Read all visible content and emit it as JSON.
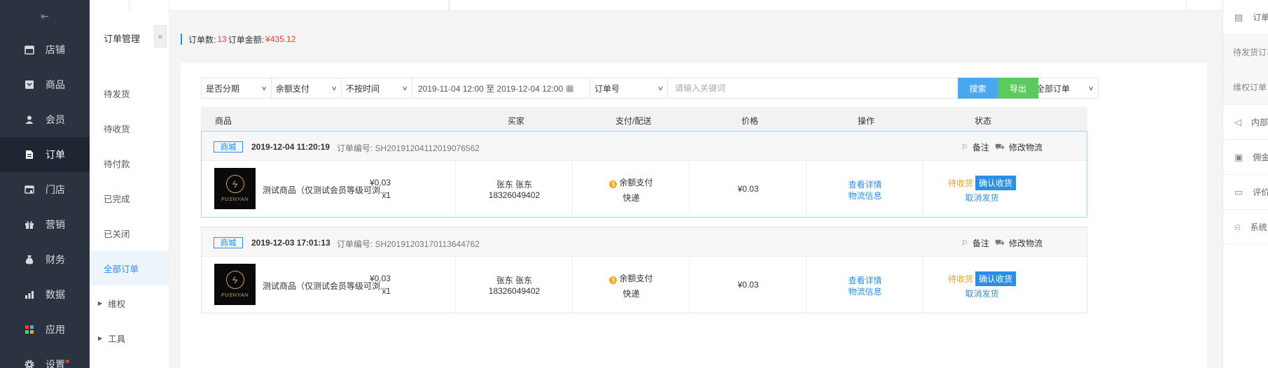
{
  "sidebar": {
    "toggle_icon": "collapse-menu-icon",
    "items": [
      {
        "label": "店铺",
        "icon": "store-icon"
      },
      {
        "label": "商品",
        "icon": "product-icon"
      },
      {
        "label": "会员",
        "icon": "member-icon"
      },
      {
        "label": "订单",
        "icon": "order-icon"
      },
      {
        "label": "门店",
        "icon": "shop-icon"
      },
      {
        "label": "营销",
        "icon": "gift-icon"
      },
      {
        "label": "财务",
        "icon": "money-bag-icon"
      },
      {
        "label": "数据",
        "icon": "chart-icon"
      },
      {
        "label": "应用",
        "icon": "apps-icon"
      },
      {
        "label": "设置",
        "icon": "gear-icon"
      }
    ],
    "active": "订单"
  },
  "submenu": {
    "title": "订单管理",
    "items": [
      "待发货",
      "待收货",
      "待付款",
      "已完成",
      "已关闭",
      "全部订单",
      "维权",
      "工具"
    ],
    "active": "全部订单"
  },
  "summary": {
    "count_label": "订单数:",
    "count": "13",
    "amount_label": "订单金额:",
    "amount": "¥435.12"
  },
  "filters": {
    "installment": "是否分期",
    "payment": "余额支付",
    "time": "不按时间",
    "date_range": "2019-11-04 12:00 至 2019-12-04 12:00",
    "field": "订单号",
    "keyword_placeholder": "请输入关键词",
    "order_scope": "全部订单",
    "search_btn": "搜索",
    "export_btn": "导出"
  },
  "table_headers": [
    "商品",
    "买家",
    "支付/配送",
    "价格",
    "操作",
    "状态"
  ],
  "orders": [
    {
      "tag": "商城",
      "datetime": "2019-12-04  11:20:19",
      "order_no": "订单编号: SH20191204112019076562",
      "remark": "备注",
      "edit_logistics": "修改物流",
      "product_name": "测试商品（仅测试会员等级可浏...",
      "product_price": "¥0.03",
      "product_qty": "x1",
      "buyer_name": "张东 张东",
      "buyer_phone": "18326049402",
      "payment": "余额支付",
      "delivery": "快递",
      "price": "¥0.03",
      "op_detail": "查看详情",
      "op_logistics": "物流信息",
      "status": "待收货",
      "confirm_btn": "确认收货",
      "cancel": "取消发货"
    },
    {
      "tag": "商城",
      "datetime": "2019-12-03  17:01:13",
      "order_no": "订单编号: SH20191203170113644762",
      "remark": "备注",
      "edit_logistics": "修改物流",
      "product_name": "测试商品（仅测试会员等级可浏...",
      "product_price": "¥0.03",
      "product_qty": "x1",
      "buyer_name": "张东 张东",
      "buyer_phone": "18326049402",
      "payment": "余额支付",
      "delivery": "快递",
      "price": "¥0.03",
      "op_detail": "查看详情",
      "op_logistics": "物流信息",
      "status": "待收货",
      "confirm_btn": "确认收货",
      "cancel": "取消发货"
    }
  ],
  "product_logo_text": "FUSNYAN",
  "right_panel": {
    "items": [
      "订单",
      "待发货订单",
      "维权订单",
      "内部",
      "佣金",
      "评价",
      "系统"
    ]
  }
}
